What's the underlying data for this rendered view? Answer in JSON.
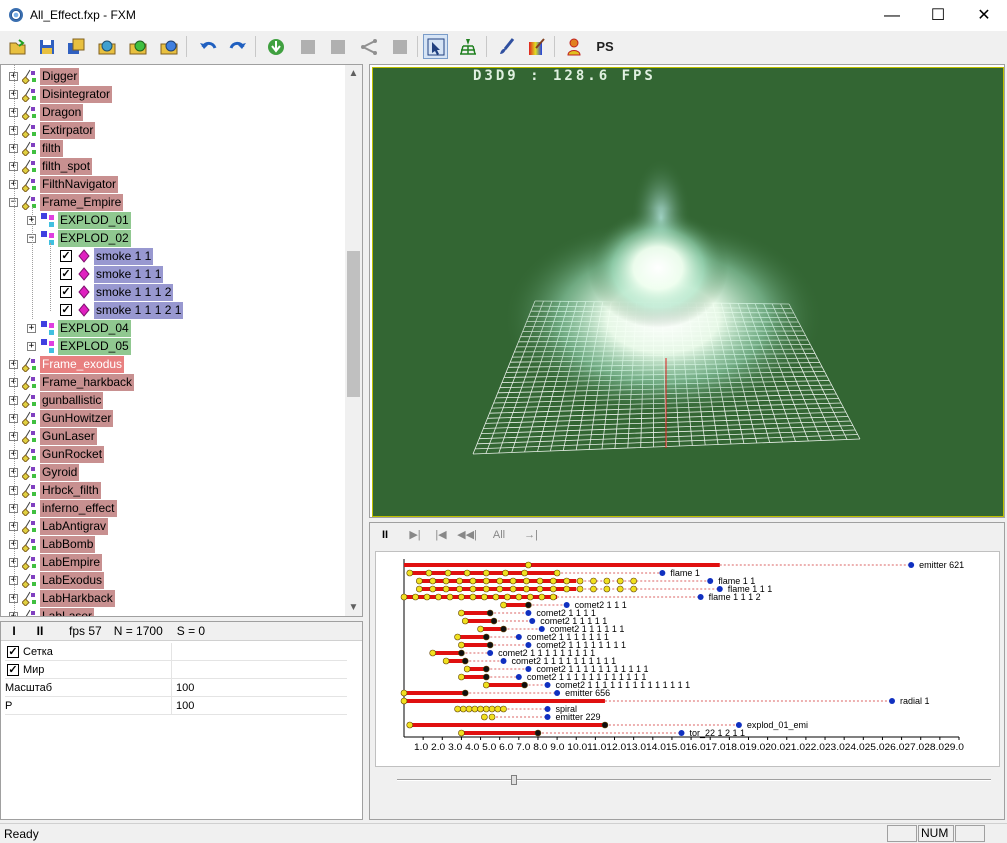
{
  "window": {
    "title": "All_Effect.fxp - FXM",
    "minimize": "—",
    "maximize": "☐",
    "close": "✕"
  },
  "toolbar": {
    "ps_label": "PS"
  },
  "tree": {
    "items": [
      {
        "label": "Digger",
        "color": "red",
        "level": 0
      },
      {
        "label": "Disintegrator",
        "color": "red",
        "level": 0
      },
      {
        "label": "Dragon",
        "color": "red",
        "level": 0
      },
      {
        "label": "Extirpator",
        "color": "red",
        "level": 0
      },
      {
        "label": "filth",
        "color": "red",
        "level": 0
      },
      {
        "label": "filth_spot",
        "color": "red",
        "level": 0
      },
      {
        "label": "FilthNavigator",
        "color": "red",
        "level": 0
      },
      {
        "label": "Frame_Empire",
        "color": "red",
        "level": 0,
        "expanded": true
      },
      {
        "label": "EXPLOD_01",
        "color": "green",
        "level": 1
      },
      {
        "label": "EXPLOD_02",
        "color": "green",
        "level": 1,
        "expanded": true
      },
      {
        "label": "smoke 1 1",
        "color": "blue",
        "level": 2,
        "checked": true
      },
      {
        "label": "smoke 1 1 1",
        "color": "blue",
        "level": 2,
        "checked": true
      },
      {
        "label": "smoke 1 1 1 2",
        "color": "blue",
        "level": 2,
        "checked": true
      },
      {
        "label": "smoke 1 1 1 2 1",
        "color": "blue",
        "level": 2,
        "checked": true
      },
      {
        "label": "EXPLOD_04",
        "color": "green",
        "level": 1
      },
      {
        "label": "EXPLOD_05",
        "color": "green",
        "level": 1
      },
      {
        "label": "Frame_exodus",
        "color": "sel",
        "level": 0
      },
      {
        "label": "Frame_harkback",
        "color": "red",
        "level": 0
      },
      {
        "label": "gunballistic",
        "color": "red",
        "level": 0
      },
      {
        "label": "GunHowitzer",
        "color": "red",
        "level": 0
      },
      {
        "label": "GunLaser",
        "color": "red",
        "level": 0
      },
      {
        "label": "GunRocket",
        "color": "red",
        "level": 0
      },
      {
        "label": "Gyroid",
        "color": "red",
        "level": 0
      },
      {
        "label": "Hrbck_filth",
        "color": "red",
        "level": 0
      },
      {
        "label": "inferno_effect",
        "color": "red",
        "level": 0
      },
      {
        "label": "LabAntigrav",
        "color": "red",
        "level": 0
      },
      {
        "label": "LabBomb",
        "color": "red",
        "level": 0
      },
      {
        "label": "LabEmpire",
        "color": "red",
        "level": 0
      },
      {
        "label": "LabExodus",
        "color": "red",
        "level": 0
      },
      {
        "label": "LabHarkback",
        "color": "red",
        "level": 0
      },
      {
        "label": "LabLaser",
        "color": "red",
        "level": 0
      }
    ]
  },
  "props": {
    "play_label": "I",
    "pause_label": "II",
    "fps": "fps 57",
    "n": "N = 1700",
    "s": "S = 0",
    "rows": [
      {
        "name": "Сетка",
        "checked": true,
        "value": ""
      },
      {
        "name": "Мир",
        "checked": true,
        "value": ""
      },
      {
        "name": "Масштаб",
        "value": "100"
      },
      {
        "name": "P",
        "value": "100"
      }
    ]
  },
  "viewport": {
    "fps_text": "D3D9  : 128.6 FPS",
    "background": "#336633"
  },
  "timeline": {
    "pause": "II",
    "step": "▶|",
    "back": "|◀",
    "rewind": "◀◀|",
    "all": "All",
    "fit": "→|←"
  },
  "chart_data": {
    "type": "timeline",
    "x_ticks": [
      "1.0",
      "2.0",
      "3.0",
      "4.0",
      "5.0",
      "6.0",
      "7.0",
      "8.0",
      "9.0",
      "10.0",
      "11.0",
      "12.0",
      "13.0",
      "14.0",
      "15.0",
      "16.0",
      "17.0",
      "18.0",
      "19.0",
      "20.0",
      "21.0",
      "22.0",
      "23.0",
      "24.0",
      "25.0",
      "26.0",
      "27.0",
      "28.0",
      "29.0"
    ],
    "x_tick_text": "1.0 2.0 3.0 4.0 5.0 6.0 7.0 8.0 9.0 10.011.012.013.014.015.016.017.018.019.020.021.022.023.024.025.026.027.028.029.0",
    "xlim": [
      0,
      29
    ],
    "rows": [
      {
        "name": "emitter 621",
        "bar": [
          0,
          16.5
        ],
        "end": 26.5,
        "markers": [
          6.5
        ]
      },
      {
        "name": "flame 1",
        "bar": [
          0.3,
          8.0
        ],
        "end": 13.5,
        "markers": [
          0.3,
          1.3,
          2.3,
          3.3,
          4.3,
          5.3,
          6.3,
          8.0
        ]
      },
      {
        "name": "flame 1 1",
        "bar": [
          0.8,
          9.0
        ],
        "end": 16.0,
        "markers": [
          0.8,
          1.5,
          2.2,
          2.9,
          3.6,
          4.3,
          5.0,
          5.7,
          6.4,
          7.1,
          7.8,
          8.5,
          9.2,
          9.9,
          10.6,
          11.3,
          12.0
        ]
      },
      {
        "name": "flame 1 1 1",
        "bar": [
          0.8,
          9.0
        ],
        "end": 16.5,
        "markers": [
          0.8,
          1.5,
          2.2,
          2.9,
          3.6,
          4.3,
          5.0,
          5.7,
          6.4,
          7.1,
          7.8,
          8.5,
          9.2,
          9.9,
          10.6,
          11.3,
          12.0
        ]
      },
      {
        "name": "flame 1 1 1 2",
        "bar": [
          0,
          8.0
        ],
        "end": 15.5,
        "markers": [
          0,
          0.6,
          1.2,
          1.8,
          2.4,
          3.0,
          3.6,
          4.2,
          4.8,
          5.4,
          6.0,
          6.6,
          7.2,
          7.8
        ]
      },
      {
        "name": "comet2 1 1 1",
        "bar": [
          5.2,
          6.5
        ],
        "end": 8.5,
        "markers": [
          5.2,
          6.5
        ]
      },
      {
        "name": "comet2 1 1 1 1",
        "bar": [
          3.0,
          4.5
        ],
        "end": 6.5,
        "markers": [
          3.0,
          4.5
        ]
      },
      {
        "name": "comet2 1 1 1 1 1",
        "bar": [
          3.2,
          4.7
        ],
        "end": 6.7,
        "markers": [
          3.2,
          4.7
        ]
      },
      {
        "name": "comet2 1 1 1 1 1 1",
        "bar": [
          4.0,
          5.2
        ],
        "end": 7.2,
        "markers": [
          4.0,
          5.2
        ]
      },
      {
        "name": "comet2 1 1 1 1 1 1 1",
        "bar": [
          2.8,
          4.3
        ],
        "end": 6.0,
        "markers": [
          2.8,
          4.3
        ]
      },
      {
        "name": "comet2 1 1 1 1 1 1 1 1",
        "bar": [
          3.0,
          4.5
        ],
        "end": 6.5,
        "markers": [
          3.0,
          4.5
        ]
      },
      {
        "name": "comet2 1 1 1 1 1 1 1 1 1",
        "bar": [
          1.5,
          3.0
        ],
        "end": 4.5,
        "markers": [
          1.5,
          3.0
        ]
      },
      {
        "name": "comet2 1 1 1 1 1 1 1 1 1 1",
        "bar": [
          2.2,
          3.2
        ],
        "end": 5.2,
        "markers": [
          2.2,
          3.2
        ]
      },
      {
        "name": "comet2 1 1 1 1 1 1 1 1 1 1 1",
        "bar": [
          3.3,
          4.3
        ],
        "end": 6.5,
        "markers": [
          3.3,
          4.3
        ]
      },
      {
        "name": "comet2 1 1 1 1 1 1 1 1 1 1 1 1",
        "bar": [
          3.0,
          4.3
        ],
        "end": 6.0,
        "markers": [
          3.0,
          4.3
        ]
      },
      {
        "name": "comet2 1 1 1 1 1 1 1 1 1 1 1 1 1 1",
        "bar": [
          4.3,
          6.3
        ],
        "end": 7.5,
        "markers": [
          4.3,
          6.3
        ]
      },
      {
        "name": "emitter 656",
        "bar": [
          0,
          3.2
        ],
        "end": 8.0,
        "markers": [
          0,
          3.2
        ]
      },
      {
        "name": "radial 1",
        "bar": [
          0,
          10.5
        ],
        "end": 25.5,
        "markers": [
          0
        ]
      },
      {
        "name": "spiral",
        "bar": null,
        "end": 7.5,
        "markers": [
          2.8,
          3.1,
          3.4,
          3.7,
          4.0,
          4.3,
          4.6,
          4.9,
          5.2
        ]
      },
      {
        "name": "emitter 229",
        "bar": null,
        "end": 7.5,
        "markers": [
          4.2,
          4.6
        ]
      },
      {
        "name": "explod_01_emi",
        "bar": [
          0.3,
          10.5
        ],
        "end": 17.5,
        "markers": [
          0.3,
          10.5
        ]
      },
      {
        "name": "tor_22 1 2 1 1",
        "bar": [
          3.0,
          7.0
        ],
        "end": 14.5,
        "markers": [
          3.0,
          7.0
        ]
      }
    ]
  },
  "status": {
    "text": "Ready",
    "num": "NUM"
  }
}
